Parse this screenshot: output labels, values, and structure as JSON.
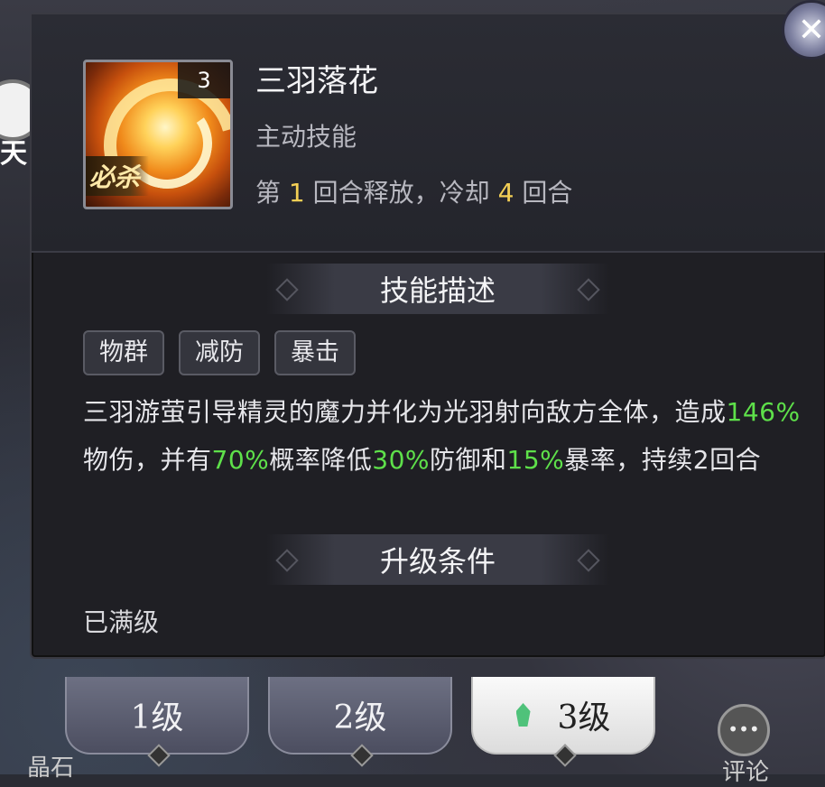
{
  "background": {
    "left_label": "天",
    "bottom_left_label": "晶石",
    "bottom_right_label": "评论"
  },
  "skill": {
    "name": "三羽落花",
    "type": "主动技能",
    "level_badge": "3",
    "icon_label": "必杀",
    "cooldown_prefix": "第",
    "release_turn": "1",
    "cooldown_middle": "回合释放，冷却",
    "cooldown_turns": "4",
    "cooldown_suffix": "回合"
  },
  "description_section": {
    "title": "技能描述",
    "tags": [
      "物群",
      "减防",
      "暴击"
    ],
    "text_parts": [
      {
        "text": "三羽游萤引导精灵的魔力并化为光羽射向敌方全体，造成",
        "highlight": false
      },
      {
        "text": "146%",
        "highlight": true
      },
      {
        "text": "物伤，并有",
        "highlight": false
      },
      {
        "text": "70%",
        "highlight": true
      },
      {
        "text": "概率降低",
        "highlight": false
      },
      {
        "text": "30%",
        "highlight": true
      },
      {
        "text": "防御和",
        "highlight": false
      },
      {
        "text": "15%",
        "highlight": true
      },
      {
        "text": "暴率，持续2回合",
        "highlight": false
      }
    ]
  },
  "upgrade_section": {
    "title": "升级条件",
    "status": "已满级"
  },
  "level_tabs": [
    {
      "label": "1级",
      "active": false
    },
    {
      "label": "2级",
      "active": false
    },
    {
      "label": "3级",
      "active": true
    }
  ],
  "colors": {
    "highlight_green": "#5ee04a",
    "highlight_yellow": "#f3cf55",
    "panel_bg": "#1f1f24"
  },
  "icons": {
    "close": "close-icon",
    "gem": "gem-icon",
    "chat": "chat-bubble-icon"
  }
}
